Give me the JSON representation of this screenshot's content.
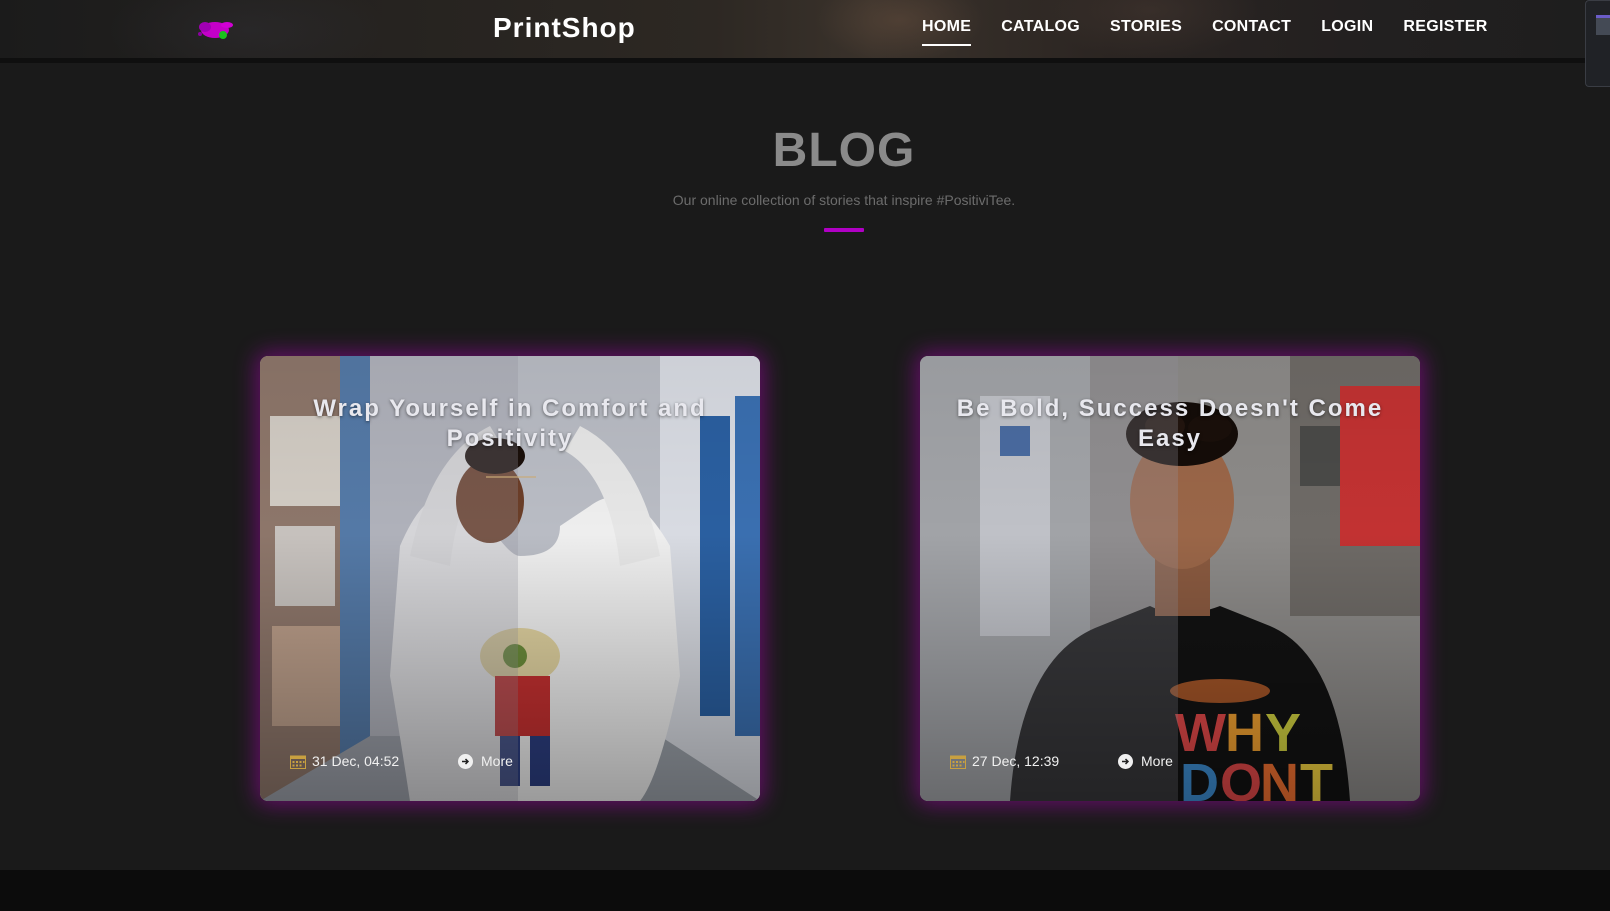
{
  "header": {
    "brand": "PrintShop",
    "nav": [
      {
        "label": "HOME",
        "active": true
      },
      {
        "label": "CATALOG",
        "active": false
      },
      {
        "label": "STORIES",
        "active": false
      },
      {
        "label": "CONTACT",
        "active": false
      },
      {
        "label": "LOGIN",
        "active": false
      },
      {
        "label": "REGISTER",
        "active": false
      }
    ]
  },
  "hero": {
    "title": "BLOG",
    "subtitle": "Our online collection of stories that inspire #PositiviTee.",
    "accent_color": "#b000c4"
  },
  "posts": [
    {
      "title": "Wrap Yourself in Comfort and Positivity",
      "date": "31 Dec, 04:52",
      "more_label": "More"
    },
    {
      "title": "Be Bold, Success Doesn't Come Easy",
      "date": "27 Dec, 12:39",
      "more_label": "More"
    }
  ],
  "icons": {
    "logo": "paint-splash-logo",
    "date": "calendar-icon",
    "more": "arrow-circle-right-icon"
  }
}
